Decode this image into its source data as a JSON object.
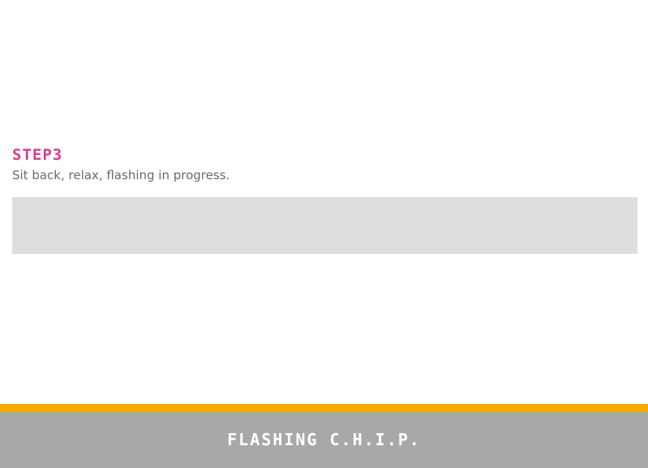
{
  "step": {
    "title": "STEP3",
    "description": "Sit back, relax, flashing in progress."
  },
  "progress": {
    "fraction": 0
  },
  "footer": {
    "title": "FLASHING C.H.I.P."
  },
  "colors": {
    "accent": "#d63c8f",
    "progress_track": "#dedede",
    "footer_accent": "#f4ab00",
    "footer_bg": "#a8a8a8",
    "text": "#6a6a6a"
  }
}
